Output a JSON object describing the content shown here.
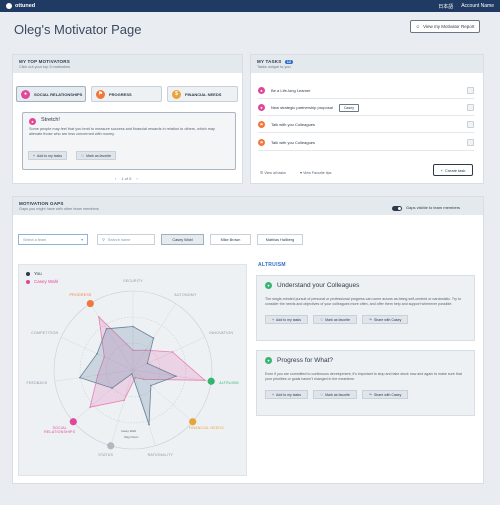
{
  "topbar": {
    "brand": "ottuned",
    "language": "日本語",
    "account": "Account Name"
  },
  "page": {
    "title": "Oleg's Motivator Page",
    "report_button": "View my Motivator Report"
  },
  "top_motivators": {
    "heading": "MY TOP MOTIVATORS",
    "subheading": "Click out your top 3 motivators",
    "items": [
      {
        "label": "SOCIAL RELATIONSHIPS",
        "color": "#e0479a",
        "icon": "people-icon"
      },
      {
        "label": "PROGRESS",
        "color": "#f2773a",
        "icon": "flag-icon"
      },
      {
        "label": "FINANCIAL NEEDS",
        "color": "#e8a43a",
        "icon": "money-icon"
      }
    ],
    "stretch": {
      "title": "Stretch!",
      "description": "Some people may feel that you tend to measure success and financial rewards in relation to others, which may alienate those who are less concerned with money.",
      "add_button": "Add to my tasks",
      "favorite_button": "Mark as favorite"
    },
    "pager": {
      "prev": "‹",
      "text": "1 of 5",
      "next": "›"
    }
  },
  "tasks": {
    "heading": "MY TASKS",
    "count": "12",
    "subheading": "Tasks unique to you",
    "items": [
      {
        "label": "Be a Life-long Learner",
        "color": "#e0479a",
        "tag": ""
      },
      {
        "label": "New strategic partnership proposal",
        "color": "#e0479a",
        "tag": "Casey"
      },
      {
        "label": "Talk with you Colleagues",
        "color": "#f2773a",
        "tag": ""
      },
      {
        "label": "Talk with you Colleagues",
        "color": "#f2773a",
        "tag": ""
      }
    ],
    "view_all": "View all tasks",
    "view_favorites": "View Favorite tips",
    "create_button": "Create task"
  },
  "gaps": {
    "heading": "MOTIVATION GAPS",
    "subheading": "Gaps you might have with other team members",
    "toggle_label": "Gaps visible to team members",
    "select_team_placeholder": "Select a team",
    "search_placeholder": "Search name",
    "people": [
      "Casey Wahl",
      "Mike Brown",
      "Mathias Hallberg"
    ],
    "legend": {
      "you": "You",
      "other": "Casey Wahl"
    },
    "axes": [
      "SECURITY",
      "AUTONOMY",
      "INNOVATION",
      "ALTRUISM",
      "FINANCIAL NEEDS",
      "RATIONALITY",
      "STATUS",
      "SOCIAL RELATIONSHIPS",
      "FEEDBACK",
      "COMPETITION",
      "PROGRESS"
    ],
    "center_label_you": "Oleg Norén",
    "center_label_other": "Casey Wahl",
    "dimension_title": "ALTRUISM",
    "cards": [
      {
        "title": "Understand your Colleagues",
        "description": "The single-minded pursuit of personal or professional progress can come across as being self-centred or narcissistic. Try to consider the needs and objectives of your colleagues more often, and offer them help and support whenever possible.",
        "add": "Add to my tasks",
        "favorite": "Mark as favorite",
        "share": "Share with Casey"
      },
      {
        "title": "Progress for What?",
        "description": "Even if you are committed to continuous development, it's important to stop and take stock now and again to make sure that your priorities or goals haven't changed in the meantime.",
        "add": "Add to my tasks",
        "favorite": "Mark as favorite",
        "share": "Share with Casey"
      }
    ]
  },
  "chart_data": {
    "type": "radar",
    "axes": [
      "SECURITY",
      "AUTONOMY",
      "INNOVATION",
      "ALTRUISM",
      "FINANCIAL NEEDS",
      "RATIONALITY",
      "STATUS",
      "SOCIAL RELATIONSHIPS",
      "FEEDBACK",
      "COMPETITION",
      "PROGRESS"
    ],
    "range": [
      0,
      100
    ],
    "series": [
      {
        "name": "You",
        "color": "#2d3a4a",
        "values": [
          55,
          48,
          20,
          55,
          30,
          72,
          5,
          35,
          68,
          50,
          62
        ]
      },
      {
        "name": "Casey Wahl",
        "color": "#e0479a",
        "values": [
          25,
          30,
          55,
          92,
          18,
          10,
          40,
          72,
          45,
          40,
          80
        ]
      }
    ]
  }
}
